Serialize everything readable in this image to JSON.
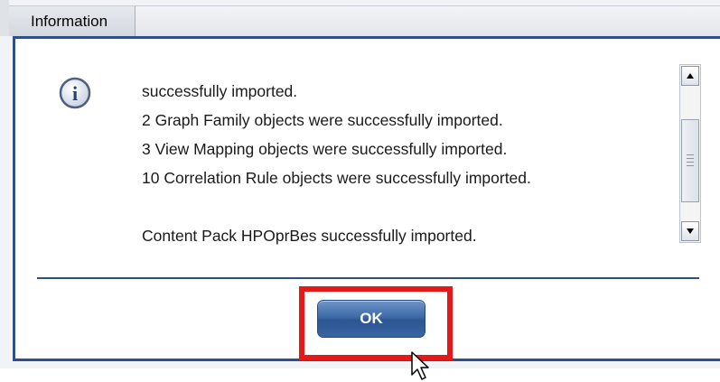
{
  "dialog": {
    "title": "Information",
    "message_lines": [
      "successfully imported.",
      "2 Graph Family objects were successfully imported.",
      "3 View Mapping objects were successfully imported.",
      "10 Correlation Rule objects were successfully imported.",
      "",
      "Content Pack HPOprBes successfully imported."
    ],
    "ok_label": "OK",
    "icon": "info-icon"
  },
  "colors": {
    "frame_border": "#2f4f86",
    "button_blue": "#3e6aa6",
    "highlight_red": "#e31a1a"
  }
}
